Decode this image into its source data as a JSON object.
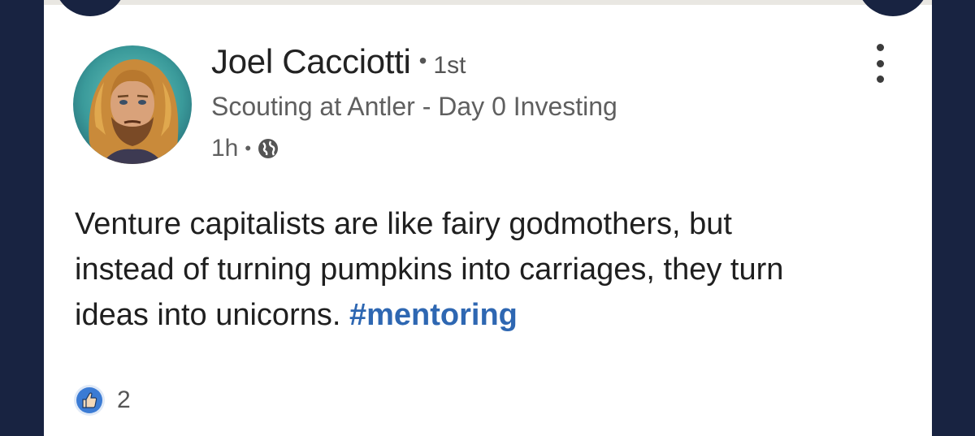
{
  "post": {
    "author": {
      "name": "Joel Cacciotti",
      "separator": "•",
      "connection_degree": "1st",
      "headline": "Scouting at Antler - Day 0 Investing",
      "avatar_icon": "avatar-portrait"
    },
    "time_posted": "1h",
    "meta_separator": "•",
    "visibility_icon": "globe-icon",
    "menu_icon": "more-vertical-icon",
    "body": {
      "line1": "Venture capitalists are like fairy godmothers, but",
      "line2": "instead of turning pumpkins into carriages, they turn",
      "line3_text": "ideas into unicorns. ",
      "hashtag": "#mentoring"
    },
    "reactions": {
      "icon": "like-icon",
      "count": "2"
    }
  },
  "colors": {
    "background": "#182341",
    "card": "#ffffff",
    "hashtag": "#2e67b2",
    "like_badge": "#3b7bd4"
  }
}
